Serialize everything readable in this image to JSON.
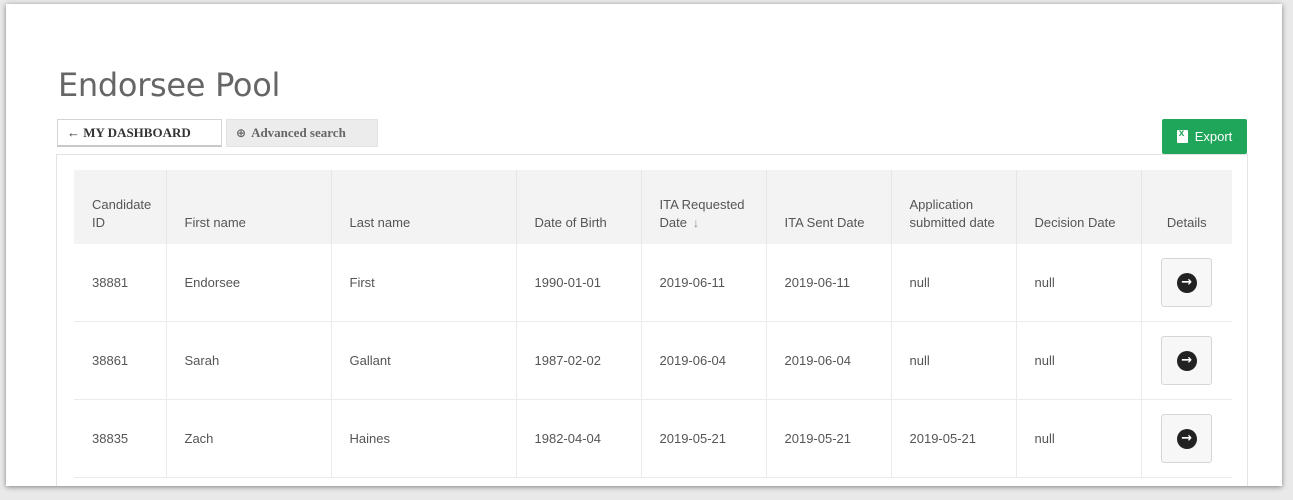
{
  "page": {
    "title": "Endorsee Pool"
  },
  "toolbar": {
    "dashboard_label": "← MY DASHBOARD",
    "advanced_label": "Advanced search",
    "export_label": "Export"
  },
  "table": {
    "headers": [
      "Candidate ID",
      "First name",
      "Last name",
      "Date of Birth",
      "ITA Requested Date",
      "ITA Sent Date",
      "Application submitted date",
      "Decision Date",
      "Details"
    ],
    "sort": {
      "column": "ITA Requested Date",
      "direction": "descending"
    },
    "rows": [
      [
        "38881",
        "Endorsee",
        "First",
        "1990-01-01",
        "2019-06-11",
        "2019-06-11",
        "null",
        "null"
      ],
      [
        "38861",
        "Sarah",
        "Gallant",
        "1987-02-02",
        "2019-06-04",
        "2019-06-04",
        "null",
        "null"
      ],
      [
        "38835",
        "Zach",
        "Haines",
        "1982-04-04",
        "2019-05-21",
        "2019-05-21",
        "2019-05-21",
        "null"
      ]
    ]
  },
  "colors": {
    "export_bg": "#1fa65a",
    "header_bg": "#f3f3f3"
  }
}
